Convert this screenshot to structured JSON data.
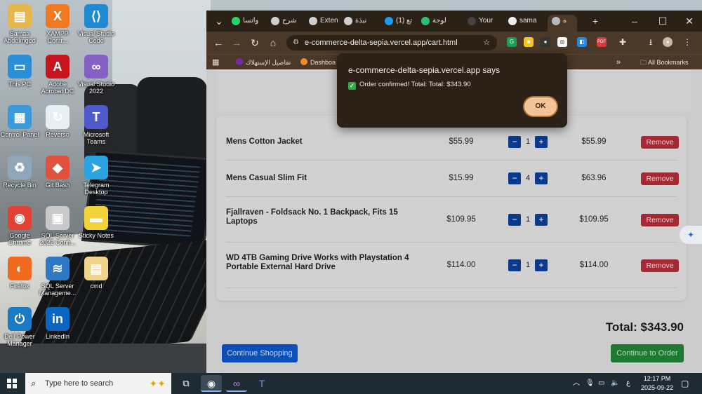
{
  "desktop": {
    "icons": [
      {
        "label": "Samaa Abdelmged",
        "icon": "user-folder-icon",
        "color": "#e7b64c",
        "glyph": "▤"
      },
      {
        "label": "XAMPP Contr...",
        "icon": "xampp-icon",
        "color": "#f07a22",
        "glyph": "X"
      },
      {
        "label": "Visual Studio Code",
        "icon": "vscode-icon",
        "color": "#1f8ad2",
        "glyph": "⟨⟩"
      },
      {
        "label": "This PC",
        "icon": "computer-icon",
        "color": "#2b8fd8",
        "glyph": "▭"
      },
      {
        "label": "Adobe Acrobat DC",
        "icon": "acrobat-icon",
        "color": "#c4161c",
        "glyph": "A"
      },
      {
        "label": "Visual Studio 2022",
        "icon": "visual-studio-icon",
        "color": "#865fc5",
        "glyph": "∞"
      },
      {
        "label": "Control Panel",
        "icon": "control-panel-icon",
        "color": "#3a9ad9",
        "glyph": "▦"
      },
      {
        "label": "Reverso",
        "icon": "reverso-icon",
        "color": "#e8eef6",
        "glyph": "↻"
      },
      {
        "label": "Microsoft Teams",
        "icon": "teams-icon",
        "color": "#5059c9",
        "glyph": "T"
      },
      {
        "label": "Recycle Bin",
        "icon": "recycle-bin-icon",
        "color": "#8fa6b8",
        "glyph": "♻"
      },
      {
        "label": "Git Bash",
        "icon": "git-bash-icon",
        "color": "#e0523c",
        "glyph": "◆"
      },
      {
        "label": "Telegram Desktop",
        "icon": "telegram-icon",
        "color": "#2aa3e0",
        "glyph": "➤"
      },
      {
        "label": "Google Chrome",
        "icon": "chrome-icon",
        "color": "#e34133",
        "glyph": "◉"
      },
      {
        "label": "SQL Server 2022 Confi...",
        "icon": "sql-server-config-icon",
        "color": "#c9c9c9",
        "glyph": "▣"
      },
      {
        "label": "Sticky Notes",
        "icon": "sticky-notes-icon",
        "color": "#f3d23a",
        "glyph": "▬"
      },
      {
        "label": "Firefox",
        "icon": "firefox-icon",
        "color": "#f06a1f",
        "glyph": "◐"
      },
      {
        "label": "SQL Server Manageme...",
        "icon": "sql-server-management-icon",
        "color": "#2f78c4",
        "glyph": "≋"
      },
      {
        "label": "cmd",
        "icon": "cmd-folder-icon",
        "color": "#f0d48a",
        "glyph": "▤"
      },
      {
        "label": "Dell Power Manager",
        "icon": "dell-power-icon",
        "color": "#1a7bc4",
        "glyph": "⏻"
      },
      {
        "label": "LinkedIn",
        "icon": "linkedin-icon",
        "color": "#0a66c2",
        "glyph": "in"
      }
    ]
  },
  "browser": {
    "tabs": [
      {
        "label": "واتسا",
        "icon": "whatsapp-icon",
        "color": "#25d366"
      },
      {
        "label": "شرح",
        "icon": "chatgpt-icon",
        "color": "#cfcfcf"
      },
      {
        "label": "Exten",
        "icon": "chatgpt-icon",
        "color": "#cfcfcf"
      },
      {
        "label": "نبذة",
        "icon": "chatgpt-icon",
        "color": "#cfcfcf"
      },
      {
        "label": "(1) تع",
        "icon": "site-icon",
        "color": "#1e9af0"
      },
      {
        "label": "لوحة",
        "icon": "k-icon",
        "color": "#2fbf71"
      },
      {
        "label": "Your",
        "icon": "upwork-icon",
        "color": "#444444"
      },
      {
        "label": "sama",
        "icon": "github-icon",
        "color": "#eeeeee"
      },
      {
        "label": "ه",
        "icon": "globe-icon",
        "color": "#bbbbbb"
      }
    ],
    "url": "e-commerce-delta-sepia.vercel.app/cart.html",
    "bookmarks": [
      {
        "label": "تفاصيل الإستهلاك",
        "icon": "we-icon",
        "color": "#7a2aa8"
      },
      {
        "label": "Dashboa",
        "icon": "fox-icon",
        "color": "#f08a24"
      }
    ],
    "all_bookmarks": "All Bookmarks"
  },
  "cart": {
    "items": [
      {
        "name": "Mens Cotton Jacket",
        "price": "$55.99",
        "qty": "1",
        "subtotal": "$55.99"
      },
      {
        "name": "Mens Casual Slim Fit",
        "price": "$15.99",
        "qty": "4",
        "subtotal": "$63.96"
      },
      {
        "name": "Fjallraven - Foldsack No. 1 Backpack, Fits 15 Laptops",
        "price": "$109.95",
        "qty": "1",
        "subtotal": "$109.95"
      },
      {
        "name": "WD 4TB Gaming Drive Works with Playstation 4 Portable External Hard Drive",
        "price": "$114.00",
        "qty": "1",
        "subtotal": "$114.00"
      }
    ],
    "minus_label": "−",
    "plus_label": "+",
    "remove_label": "Remove",
    "total": "Total: $343.90",
    "continue_shopping": "Continue Shopping",
    "continue_order": "Continue to Order"
  },
  "dialog": {
    "title": "e-commerce-delta-sepia.vercel.app says",
    "message": "Order confirmed! Total: Total: $343.90",
    "ok": "OK"
  },
  "taskbar": {
    "search_placeholder": "Type here to search",
    "language": "ع",
    "time": "12:17 PM",
    "date": "2025-09-22"
  }
}
